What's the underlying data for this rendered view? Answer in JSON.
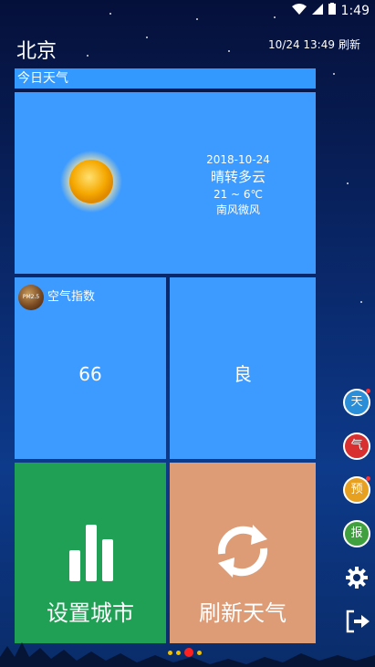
{
  "status_bar": {
    "time": "1:49"
  },
  "header": {
    "city": "北京",
    "updated": "10/24 13:49",
    "refresh_label": "刷新"
  },
  "today_title": "今日天气",
  "weather": {
    "date": "2018-10-24",
    "condition": "晴转多云",
    "temp_range": "21 ~ 6℃",
    "wind": "南风微风"
  },
  "air": {
    "label": "空气指数",
    "badge": "PM2.5",
    "value": "66",
    "grade": "良"
  },
  "actions": {
    "set_city": "设置城市",
    "refresh_weather": "刷新天气"
  },
  "side_buttons": [
    {
      "label": "天",
      "color": "#2a8fd8",
      "dot": true
    },
    {
      "label": "气",
      "color": "#d83030",
      "dot": false
    },
    {
      "label": "预",
      "color": "#e8a020",
      "dot": true
    },
    {
      "label": "报",
      "color": "#40a040",
      "dot": false
    }
  ],
  "colors": {
    "tile_blue": "#3d9bff",
    "set_city_green": "#20a055",
    "refresh_orange": "#dd9c76"
  },
  "pager": {
    "active_index": 2,
    "count": 4
  }
}
